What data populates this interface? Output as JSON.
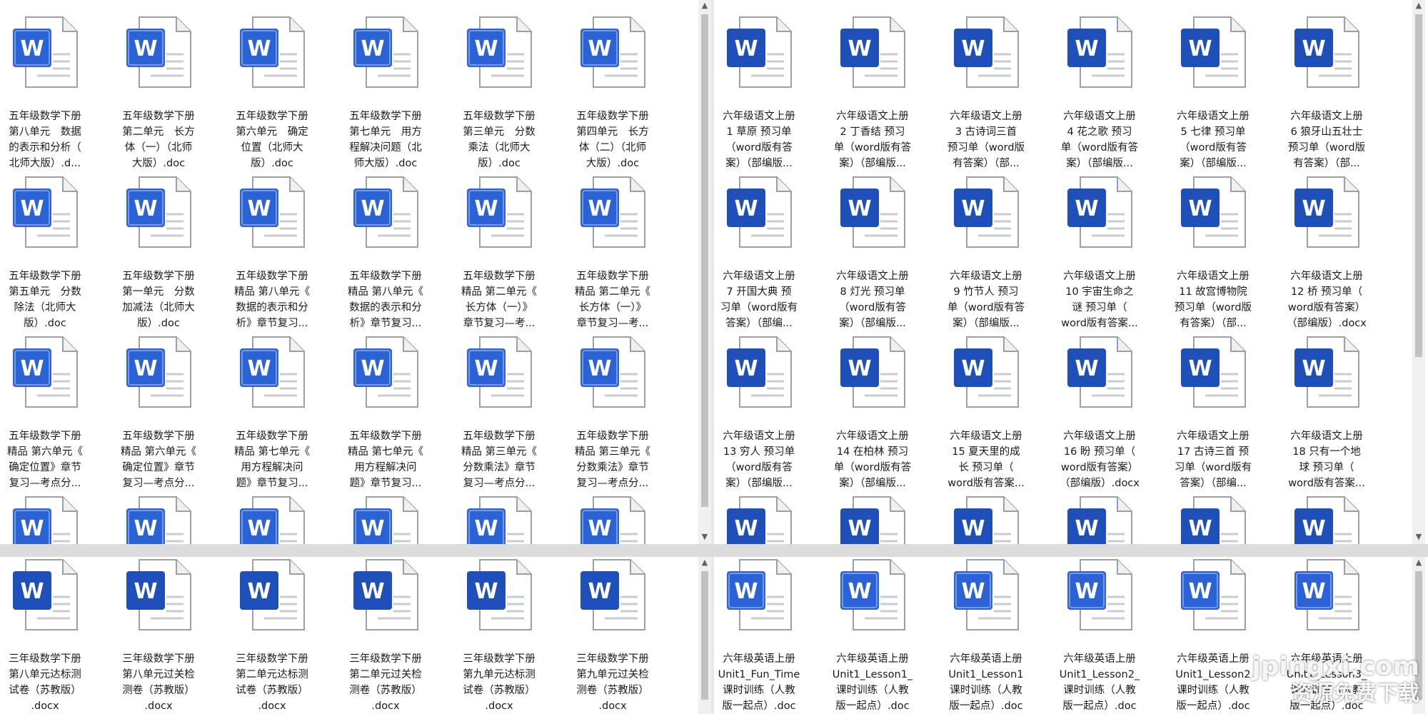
{
  "panes": {
    "top_left": [
      [
        "五年级数学下册\n第八单元　数据\n的表示和分析（\n北师大版）.d...",
        "五年级数学下册\n第二单元　长方\n体（一）（北师\n大版）.doc",
        "五年级数学下册\n第六单元　确定\n位置（北师大\n版）.doc",
        "五年级数学下册\n第七单元　用方\n程解决问题（北\n师大版）.doc",
        "五年级数学下册\n第三单元　分数\n乘法（北师大\n版）.doc",
        "五年级数学下册\n第四单元　长方\n体（二）（北师\n大版）.doc"
      ],
      [
        "五年级数学下册\n第五单元　分数\n除法（北师大\n版）.doc",
        "五年级数学下册\n第一单元　分数\n加减法（北师大\n版）.doc",
        "五年级数学下册\n精品 第八单元《\n数据的表示和分\n析》章节复习...",
        "五年级数学下册\n精品 第八单元《\n数据的表示和分\n析》章节复习...",
        "五年级数学下册\n精品 第二单元《\n长方体（一）》\n章节复习—考...",
        "五年级数学下册\n精品 第二单元《\n长方体（一）》\n章节复习—考..."
      ],
      [
        "五年级数学下册\n精品 第六单元《\n确定位置》章节\n复习—考点分...",
        "五年级数学下册\n精品 第六单元《\n确定位置》章节\n复习—考点分...",
        "五年级数学下册\n精品 第七单元《\n用方程解决问\n题》章节复习...",
        "五年级数学下册\n精品 第七单元《\n用方程解决问\n题》章节复习...",
        "五年级数学下册\n精品 第三单元《\n分数乘法》章节\n复习—考点分...",
        "五年级数学下册\n精品 第三单元《\n分数乘法》章节\n复习—考点分..."
      ],
      [
        "",
        "",
        "",
        "",
        "",
        ""
      ]
    ],
    "top_right": [
      [
        "六年级语文上册\n1 草原 预习单\n（word版有答\n案）（部编版...",
        "六年级语文上册\n2 丁香结 预习\n单（word版有答\n案）（部编版...",
        "六年级语文上册\n3 古诗词三首\n预习单（word版\n有答案）（部...",
        "六年级语文上册\n4 花之歌 预习\n单（word版有答\n案）（部编版...",
        "六年级语文上册\n5 七律 预习单\n（word版有答\n案）（部编版...",
        "六年级语文上册\n6 狼牙山五壮士\n预习单（word版\n有答案）（部..."
      ],
      [
        "六年级语文上册\n7 开国大典 预\n习单（word版有\n答案）（部编...",
        "六年级语文上册\n8 灯光 预习单\n（word版有答\n案）（部编版...",
        "六年级语文上册\n9 竹节人 预习\n单（word版有答\n案）（部编版...",
        "六年级语文上册\n10 宇宙生命之\n谜 预习单（\nword版有答案...",
        "六年级语文上册\n11 故宫博物院\n预习单（word版\n有答案）（部...",
        "六年级语文上册\n12 桥 预习单（\nword版有答案）\n（部编版）.docx"
      ],
      [
        "六年级语文上册\n13 穷人 预习单\n（word版有答\n案）（部编版...",
        "六年级语文上册\n14 在柏林 预习\n单（word版有答\n案）（部编版...",
        "六年级语文上册\n15 夏天里的成\n长 预习单（\nword版有答案...",
        "六年级语文上册\n16 盼 预习单（\nword版有答案）\n（部编版）.docx",
        "六年级语文上册\n17 古诗三首 预\n习单（word版有\n答案）（部编...",
        "六年级语文上册\n18 只有一个地\n球 预习单（\nword版有答案..."
      ],
      [
        "",
        "",
        "",
        "",
        "",
        ""
      ]
    ],
    "bottom_left": [
      [
        "三年级数学下册\n第八单元达标测\n试卷（苏教版）\n.docx",
        "三年级数学下册\n第八单元过关检\n测卷（苏教版）\n.docx",
        "三年级数学下册\n第二单元达标测\n试卷（苏教版）\n.docx",
        "三年级数学下册\n第二单元过关检\n测卷（苏教版）\n.docx",
        "三年级数学下册\n第九单元达标测\n试卷（苏教版）\n.docx",
        "三年级数学下册\n第九单元过关检\n测卷（苏教版）\n.docx"
      ]
    ],
    "bottom_right": [
      [
        "六年级英语上册\nUnit1_Fun_Time\n课时训练（人教\n版一起点）.doc",
        "六年级英语上册\nUnit1_Lesson1_\n课时训练（人教\n版一起点）.doc",
        "六年级英语上册\nUnit1_Lesson1\n课时训练（人教\n版一起点）.doc",
        "六年级英语上册\nUnit1_Lesson2_\n课时训练（人教\n版一起点）.doc",
        "六年级英语上册\nUnit1_Lesson2\n课时训练（人教\n版一起点）.doc",
        "六年级英语上册\nUnit1_Lesson3_\n课时训练（人教\n版一起点）.doc"
      ]
    ]
  },
  "icons": {
    "glyph": "W",
    "accent": "#2b62d6",
    "accent_dark": "#1f4fb8",
    "page_fill": "#ffffff",
    "page_stroke": "#9aa0a6"
  },
  "scrollbar": {
    "up": "▲",
    "down": "▼"
  },
  "watermark": {
    "line1": "jpingxi.com",
    "line2": "资源免费下载"
  }
}
